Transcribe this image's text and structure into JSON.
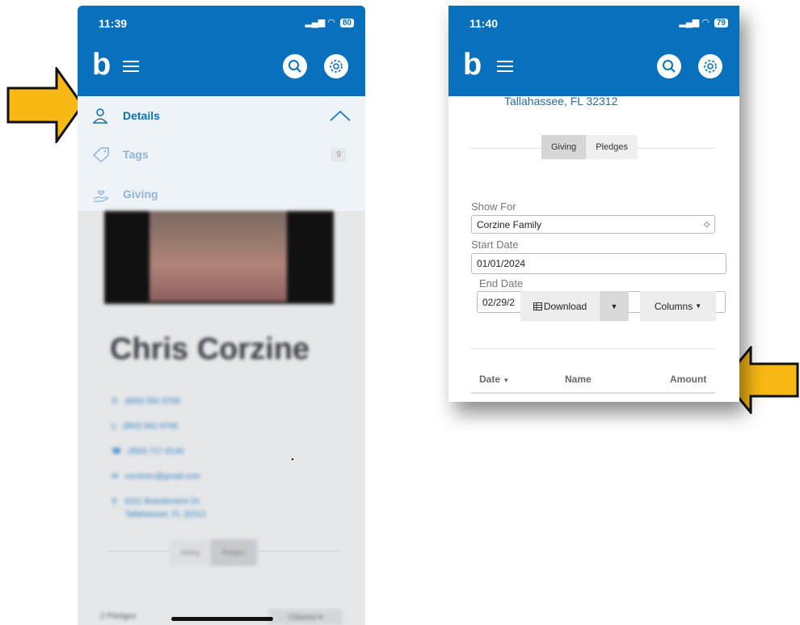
{
  "left_phone": {
    "time": "11:39",
    "battery": "80",
    "menu": [
      {
        "label": "Details"
      },
      {
        "label": "Tags",
        "badge": "9"
      },
      {
        "label": "Giving"
      }
    ],
    "profile": {
      "name": "Chris Corzine",
      "phone1": "(850) 591-9706",
      "phone2": "(850) 591-9706",
      "phone3": "(850) 717-8140",
      "email": "corzinec@gmail.com",
      "address1": "3101 Brandemere Dr.",
      "address2": "Tallahassee, FL 32312"
    },
    "tabs": [
      "Giving",
      "Pledges"
    ],
    "pledges_count": "2 Pledges",
    "columns_label": "Columns"
  },
  "right_phone": {
    "time": "11:40",
    "battery": "79",
    "address_line": "Tallahassee, FL 32312",
    "tabs": [
      "Giving",
      "Pledges"
    ],
    "show_for_label": "Show For",
    "show_for_value": "Corzine Family",
    "start_date_label": "Start Date",
    "start_date_value": "01/01/2024",
    "end_date_label": "End Date",
    "end_date_value": "02/29/2",
    "download_label": "Download",
    "columns_label": "Columns",
    "table_headers": [
      "Date",
      "Name",
      "Amount"
    ]
  },
  "colors": {
    "brand": "#0870bd",
    "arrow_fill": "#f9b914"
  }
}
